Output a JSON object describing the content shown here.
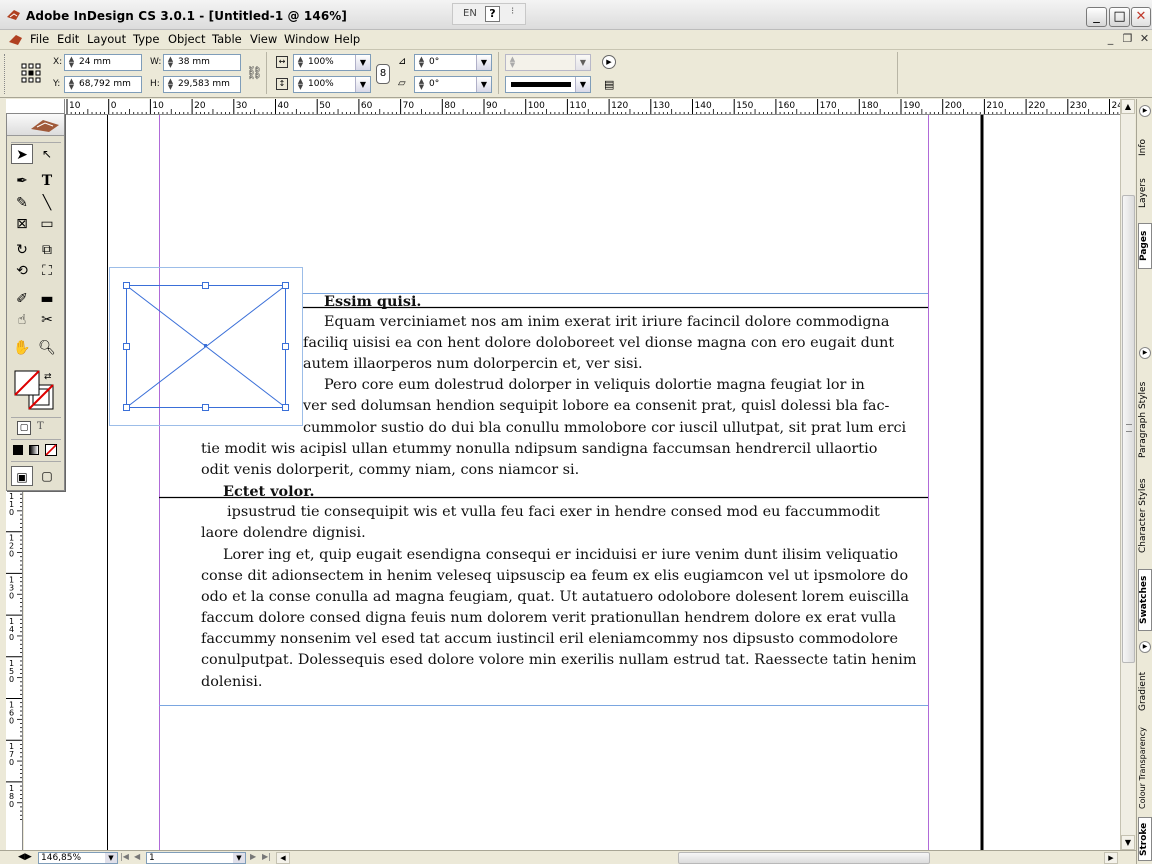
{
  "window": {
    "title": "Adobe InDesign CS 3.0.1 - [Untitled-1 @ 146%]",
    "lang": "EN",
    "help_glyph": "?",
    "minimize": "_",
    "maximize": "□",
    "close": "✕",
    "doc_minimize": "_",
    "doc_restore": "❐",
    "doc_close": "✕"
  },
  "menu": {
    "items": [
      "File",
      "Edit",
      "Layout",
      "Type",
      "Object",
      "Table",
      "View",
      "Window",
      "Help"
    ]
  },
  "control": {
    "x_label": "X:",
    "x_value": "24 mm",
    "y_label": "Y:",
    "y_value": "68,792 mm",
    "w_label": "W:",
    "w_value": "38 mm",
    "h_label": "H:",
    "h_value": "29,583 mm",
    "scale_x": "100%",
    "scale_y": "100%",
    "rotate": "0°",
    "shear": "0°"
  },
  "ruler": {
    "top_labels": [
      "10",
      "0",
      "10",
      "20",
      "30",
      "40",
      "50",
      "60",
      "70",
      "80",
      "90",
      "100",
      "110",
      "120",
      "130",
      "140",
      "150",
      "160",
      "170",
      "180",
      "190",
      "200",
      "210",
      "220",
      "230",
      "24"
    ],
    "left_labels": [
      "1\n1\n0",
      "1\n2\n0",
      "1\n3\n0",
      "1\n4\n0",
      "1\n5\n0",
      "1\n6\n0",
      "1\n7\n0",
      "1\n8\n0"
    ]
  },
  "document": {
    "heading1": "Essim quisi.",
    "lines1": [
      "Equam verciniamet nos am inim exerat irit iriure facincil dolore commodigna",
      "faciliq uisisi ea con hent dolore doloboreet vel dionse magna con ero eugait dunt",
      "autem illaorperos num dolorpercin et, ver sisi.",
      "Pero core eum dolestrud dolorper in veliquis dolortie magna feugiat lor in",
      "ver sed dolumsan hendion sequipit lobore ea consenit prat, quisl dolessi bla fac-",
      "cummolor sustio do dui bla conullu mmolobore cor iuscil ullutpat, sit prat lum erci",
      "tie modit wis acipisl ullan etummy nonulla ndipsum sandigna faccumsan hendrercil ullaortio",
      "odit venis dolorperit, commy niam, cons niamcor si."
    ],
    "heading2": "Ectet volor.",
    "lines2": [
      "ipsustrud tie consequipit wis et vulla feu faci exer in hendre consed mod eu faccummodit",
      "laore dolendre dignisi.",
      "Lorer ing et, quip eugait esendigna consequi er inciduisi er iure venim dunt ilisim veliquatio",
      "conse dit adionsectem in henim veleseq uipsuscip ea feum ex elis eugiamcon vel ut ipsmolore do",
      "odo et la conse conulla ad magna feugiam, quat. Ut autatuero odolobore dolesent lorem euiscilla",
      "faccum dolore consed digna feuis num dolorem verit prationullan hendrem dolore ex erat vulla",
      "faccummy nonsenim vel esed tat accum iustincil eril eleniamcommy nos dipsusto commodolore",
      "conulputpat. Dolessequis esed dolore volore min exerilis nullam estrud tat. Raessecte tatin henim",
      "dolenisi."
    ]
  },
  "panels": {
    "tabs": [
      "Info",
      "Layers",
      "Pages",
      "Paragraph Styles",
      "Character Styles",
      "Swatches",
      "Gradient",
      "Colour Transparency",
      "Stroke"
    ]
  },
  "status": {
    "zoom": "146,85%",
    "page": "1"
  },
  "colors": {
    "guide_blue": "#7aa6e0",
    "margin_purple": "#b06ad8",
    "frame_blue": "#3a6fd8"
  }
}
